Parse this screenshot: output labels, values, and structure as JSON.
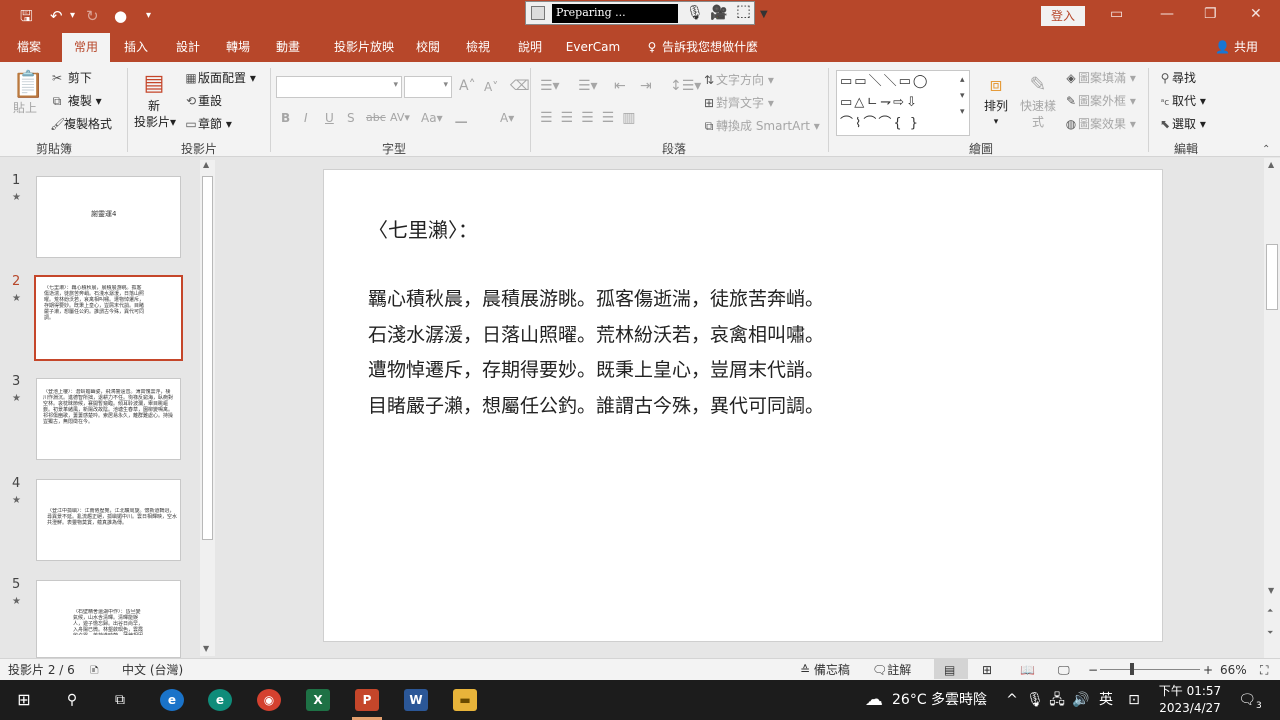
{
  "titlebar": {
    "recorder_status": "Preparing ...",
    "signin_label": "登入"
  },
  "tabs": [
    "檔案",
    "常用",
    "插入",
    "設計",
    "轉場",
    "動畫",
    "投影片放映",
    "校閱",
    "檢視",
    "說明",
    "EverCam",
    "告訴我您想做什麼"
  ],
  "active_tab": "常用",
  "share_label": "共用",
  "ribbon": {
    "clipboard": {
      "paste": "貼上",
      "cut": "剪下",
      "copy": "複製",
      "format_painter": "複製格式",
      "label": "剪貼簿"
    },
    "slides": {
      "new_slide_1": "新",
      "new_slide_2": "投影片",
      "layout": "版面配置",
      "reset": "重設",
      "section": "章節",
      "label": "投影片"
    },
    "font": {
      "label": "字型",
      "bold": "B",
      "italic": "I",
      "underline": "U",
      "shadow": "S",
      "strike": "abc",
      "spacing": "AV",
      "case": "Aa",
      "color": "A",
      "grow": "A",
      "shrink": "A"
    },
    "paragraph": {
      "text_direction": "文字方向",
      "align_text": "對齊文字",
      "smartart": "轉換成 SmartArt",
      "label": "段落"
    },
    "drawing": {
      "arrange": "排列",
      "quick_styles_1": "快速樣",
      "quick_styles_2": "式",
      "shape_fill": "圖案填滿",
      "shape_outline": "圖案外框",
      "shape_effects": "圖案效果",
      "label": "繪圖"
    },
    "editing": {
      "find": "尋找",
      "replace": "取代",
      "select": "選取",
      "label": "編輯"
    }
  },
  "thumbnails": [
    {
      "num": "1",
      "star": "★",
      "text": "謝靈運4"
    },
    {
      "num": "2",
      "star": "★",
      "text": "〈七里瀨〉：羈心積秋晨，晨積展游眺。孤客傷逝湍，徒旅苦奔峭。石淺水潺湲，日落山照曜。荒林紛沃若，哀禽相叫嘯。遭物悼遷斥，存期得要妙。既秉上皇心，豈屑末代誚。目睹嚴子瀨，想屬任公釣。誰謂古今殊，異代可同調。"
    },
    {
      "num": "3",
      "star": "★",
      "text": "〈登池上樓〉：潛虯媚幽姿，飛鴻響遠音。薄霄愧雲浮，棲川怍淵沉。進德智所拙，退耕力不任。徇祿反窮海，臥痾對空林。衾枕昧節候，褰開暫窺臨。傾耳聆波瀾，舉目眺嶇嶔。初景革緒風，新陽改故陰。池塘生春草，園柳變鳴禽。祁祁傷豳歌，萋萋感楚吟。索居易永久，離群難處心。持操豈獨古，無悶徵在今。"
    },
    {
      "num": "4",
      "star": "★",
      "text": "〈登江中孤嶼〉：江南倦歷覽，江北曠周旋。懷新道轉迥，尋異景不延。亂流趨正絕，孤嶼媚中川。雲日相輝映，空水共澄鮮。表靈物莫賞，蘊真誰為傳。"
    },
    {
      "num": "5",
      "star": "★",
      "text": "〈石壁精舍還湖中作〉：昏旦變氣候，山水含清暉。清暉能娛人，遊子憺忘歸。出谷日尚早，入舟陽已微。林壑斂暝色，雲霞收夕霏。芰荷迭映蔚，蒲稗相因依。"
    }
  ],
  "slide": {
    "title": "〈七里瀨〉：",
    "lines": [
      "羈心積秋晨，晨積展游眺。孤客傷逝湍，徒旅苦奔峭。",
      "石淺水潺湲，日落山照曜。荒林紛沃若，哀禽相叫嘯。",
      "遭物悼遷斥，存期得要妙。既秉上皇心，豈屑末代誚。",
      "目睹嚴子瀨，想屬任公釣。誰謂古今殊，異代可同調。"
    ]
  },
  "statusbar": {
    "slide_count": "投影片 2 / 6",
    "language": "中文 (台灣)",
    "notes": "備忘稿",
    "comments": "註解",
    "zoom": "66%"
  },
  "taskbar": {
    "weather": "26°C  多雲時陰",
    "ime": "英",
    "time": "下午 01:57",
    "date": "2023/4/27",
    "notifications": "3"
  },
  "colors": {
    "accent": "#b7472a",
    "slide_bg": "#ffffff",
    "taskbar": "#1c1c1c"
  }
}
